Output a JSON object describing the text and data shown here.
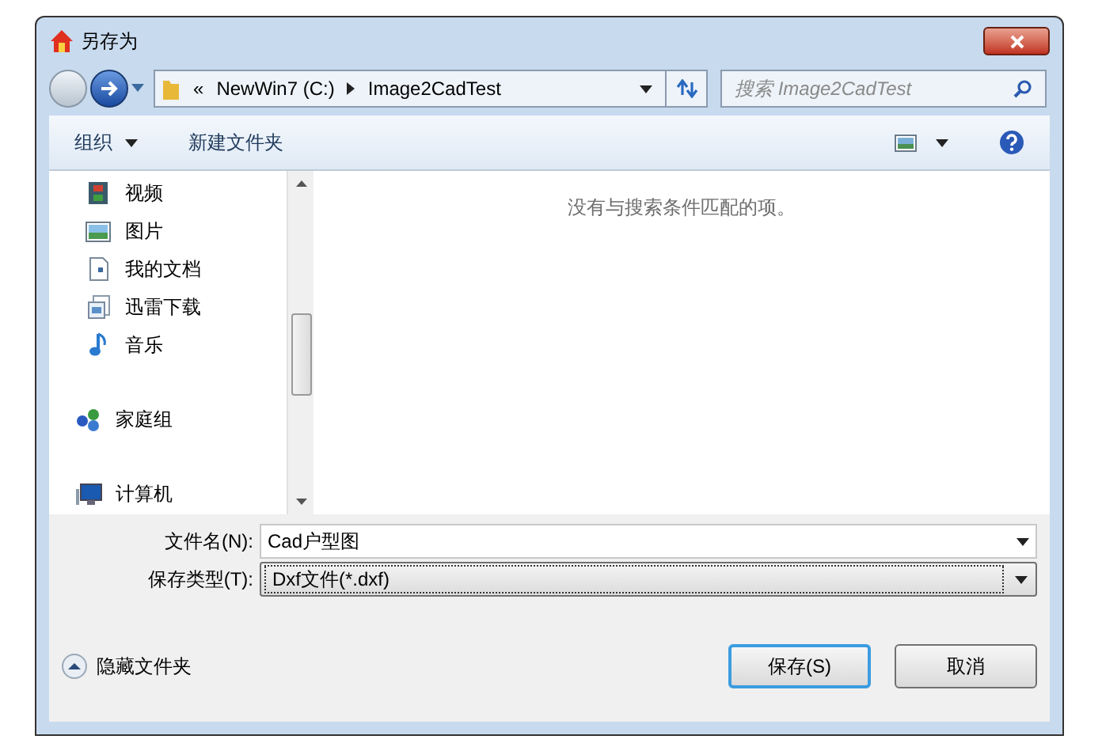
{
  "window": {
    "title": "另存为"
  },
  "address": {
    "overflow": "«",
    "crumbs": [
      "NewWin7 (C:)",
      "Image2CadTest"
    ]
  },
  "search": {
    "placeholder": "搜索 Image2CadTest"
  },
  "toolbar": {
    "organize": "组织",
    "new_folder": "新建文件夹"
  },
  "sidebar": {
    "items": [
      {
        "label": "视频",
        "kind": "video",
        "group": false
      },
      {
        "label": "图片",
        "kind": "pictures",
        "group": false
      },
      {
        "label": "我的文档",
        "kind": "document",
        "group": false
      },
      {
        "label": "迅雷下载",
        "kind": "download",
        "group": false
      },
      {
        "label": "音乐",
        "kind": "music",
        "group": false
      },
      {
        "label": "家庭组",
        "kind": "homegroup",
        "group": true
      },
      {
        "label": "计算机",
        "kind": "computer",
        "group": true
      }
    ]
  },
  "content": {
    "empty_message": "没有与搜索条件匹配的项。"
  },
  "form": {
    "filename_label": "文件名(N):",
    "filename": "Cad户型图",
    "type_label": "保存类型(T):",
    "type": "Dxf文件(*.dxf)"
  },
  "hide_folders": "隐藏文件夹",
  "buttons": [
    {
      "label": "保存(S)",
      "default": true
    },
    {
      "label": "取消",
      "default": false
    }
  ]
}
